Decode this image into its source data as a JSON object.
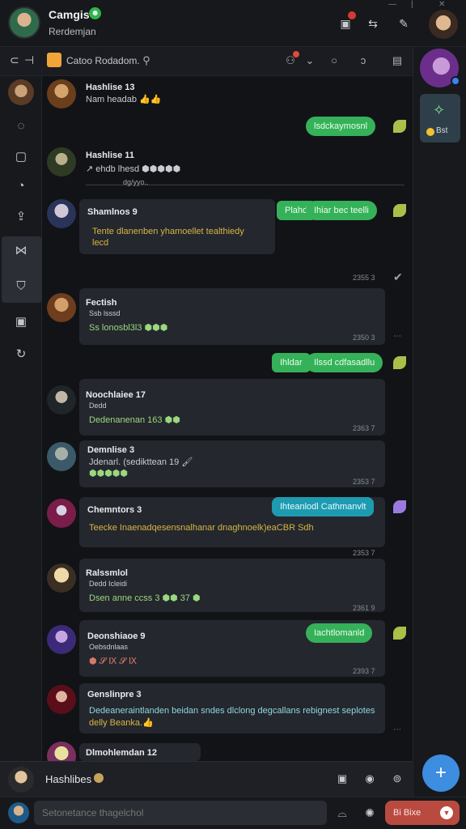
{
  "header": {
    "title": "Camgis",
    "subtitle": "Rerdemjan",
    "online_glyph": "☻"
  },
  "toolbar": {
    "channel_name": "Catoo Rodadom."
  },
  "rail": {
    "active_index": 4
  },
  "right_rail": {
    "card_label": "Bst"
  },
  "messages": [
    {
      "name": "Hashlise 13",
      "text": "Nam headab 👍👍",
      "text_color": "plain"
    },
    {
      "name": "Hashlise 11",
      "text": "↗ ehdb lhesd ⬢⬢⬢⬢⬢",
      "text_color": "plain"
    },
    {
      "name": "Shamlnos 9",
      "text": "Tente dlanenben yhamoellet tealthiedy",
      "text2": "lecd",
      "text_color": "gold"
    },
    {
      "name": "Fectish",
      "sub": "Ssb lsssd",
      "text": "Ss lonosbl3l3 ⬢⬢⬢",
      "time": "2350 3",
      "text_color": "green"
    },
    {
      "name": "Noochlaiee 17",
      "sub": "Dedd",
      "text": "Dedenanenan 163 ⬢⬢",
      "time": "2363 7",
      "text_color": "green"
    },
    {
      "name": "Demnlise 3",
      "text": "Jdenarl. (sedikttean 19 🖌",
      "text2": "⬢⬢⬢⬢⬢",
      "time": "2353 7",
      "text_color": "plain"
    },
    {
      "name": "Chemntors 3",
      "text": "Teecke Inaenadqesensnalhanar dnaghnoelk)eaCBR Sdh",
      "time": "2353 7",
      "text_color": "gold"
    },
    {
      "name": "Ralssmlol",
      "sub": "Dedd Icleidi",
      "text": "Dsen anne ccss 3 ⬢⬢ 37 ⬢",
      "time": "2361 9",
      "text_color": "green"
    },
    {
      "name": "Deonshiaoe 9",
      "sub": "Oebsdnlaas",
      "text": "⬢ 𝓢 Ⅸ 𝓢 Ⅸ",
      "time": "2393 7",
      "text_color": "plain"
    },
    {
      "name": "Genslinpre 3",
      "text": "Dedeaneraintlanden beidan sndes dlclong degcallans rebignest seplotes",
      "text2": "delly Beanka.👍",
      "text_color": "cyan"
    },
    {
      "name": "Dlmohlemdan 12",
      "text": "",
      "text_color": "plain"
    }
  ],
  "replies": [
    {
      "label": "lsdckaymosnl",
      "color": "green"
    },
    {
      "label": "Ihiar bec teelli",
      "prefix": "Plahd",
      "color": "green"
    },
    {
      "label": "Ilssd cdfasadllu",
      "prefix": "Ihldar",
      "color": "green"
    },
    {
      "label": "Ihteanlodl Cathmanvlt",
      "color": "teal"
    },
    {
      "label": "Iachtlomanld",
      "color": "green"
    }
  ],
  "timestamps": {
    "t1": "2355 3",
    "t2": "2353 7"
  },
  "divider_text": "dg/yyo..",
  "now_bar": {
    "label": "Hashlibes"
  },
  "compose": {
    "placeholder": "Setonetance thagelchol",
    "send_label": "Bi Bixe"
  }
}
